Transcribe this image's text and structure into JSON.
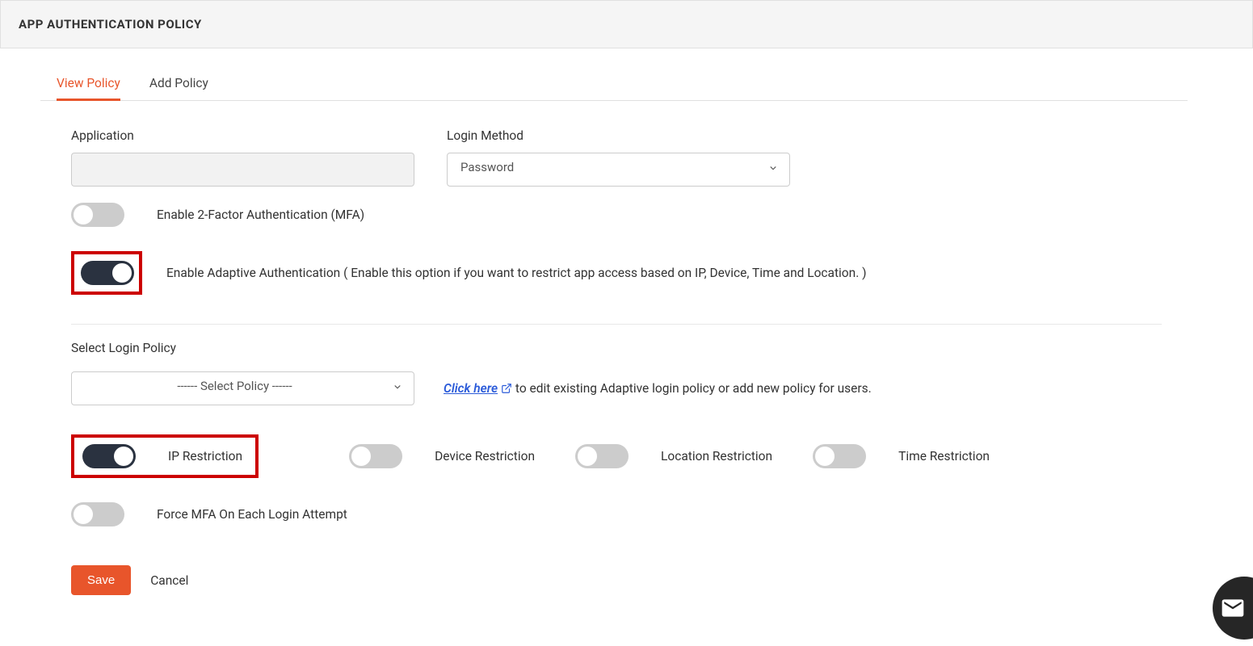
{
  "header": {
    "title": "APP AUTHENTICATION POLICY"
  },
  "tabs": {
    "view": "View Policy",
    "add": "Add Policy"
  },
  "fields": {
    "application_label": "Application",
    "application_value": "",
    "login_method_label": "Login Method",
    "login_method_value": "Password",
    "mfa_toggle_label": "Enable 2-Factor Authentication (MFA)",
    "adaptive_toggle_label": "Enable Adaptive Authentication ( Enable this option if you want to restrict app access based on IP, Device, Time and Location. )",
    "select_login_policy_label": "Select Login Policy",
    "select_login_policy_value": "------ Select Policy ------",
    "hint_link": "Click here",
    "hint_text": " to edit existing Adaptive login policy or add new policy for users.",
    "ip_restriction_label": "IP Restriction",
    "device_restriction_label": "Device Restriction",
    "location_restriction_label": "Location Restriction",
    "time_restriction_label": "Time Restriction",
    "force_mfa_label": "Force MFA On Each Login Attempt"
  },
  "actions": {
    "save": "Save",
    "cancel": "Cancel"
  }
}
